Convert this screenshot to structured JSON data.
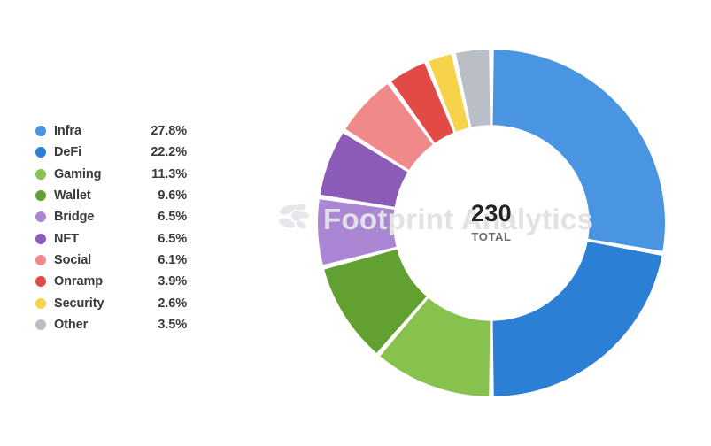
{
  "center": {
    "value": "230",
    "label": "TOTAL"
  },
  "watermark": {
    "text": "Footprint Analytics",
    "icon": "footprint-pinwheel-logo",
    "color": "#e2e2e6"
  },
  "legend": {
    "items": [
      {
        "label": "Infra",
        "value": "27.8%",
        "color": "#4a95e2"
      },
      {
        "label": "DeFi",
        "value": "22.2%",
        "color": "#2b7fd4"
      },
      {
        "label": "Gaming",
        "value": "11.3%",
        "color": "#86c24d"
      },
      {
        "label": "Wallet",
        "value": "9.6%",
        "color": "#63a032"
      },
      {
        "label": "Bridge",
        "value": "6.5%",
        "color": "#ab86d4"
      },
      {
        "label": "NFT",
        "value": "6.5%",
        "color": "#8b5bb8"
      },
      {
        "label": "Social",
        "value": "6.1%",
        "color": "#f08a8a"
      },
      {
        "label": "Onramp",
        "value": "3.9%",
        "color": "#e24b45"
      },
      {
        "label": "Security",
        "value": "2.6%",
        "color": "#f6d349"
      },
      {
        "label": "Other",
        "value": "3.5%",
        "color": "#b9bec7"
      }
    ]
  },
  "chart_data": {
    "type": "pie",
    "variant": "donut",
    "title": "",
    "total": 230,
    "total_label": "TOTAL",
    "unit": "%",
    "start_angle_deg": 0,
    "direction": "clockwise",
    "inner_radius_ratio": 0.565,
    "gap_deg": 1.6,
    "legend_position": "left",
    "categories": [
      "Infra",
      "DeFi",
      "Gaming",
      "Wallet",
      "Bridge",
      "NFT",
      "Social",
      "Onramp",
      "Security",
      "Other"
    ],
    "values": [
      27.8,
      22.2,
      11.3,
      9.6,
      6.5,
      6.5,
      6.1,
      3.9,
      2.6,
      3.5
    ],
    "colors": [
      "#4a95e2",
      "#2b7fd4",
      "#86c24d",
      "#63a032",
      "#ab86d4",
      "#8b5bb8",
      "#f08a8a",
      "#e24b45",
      "#f6d349",
      "#b9bec7"
    ],
    "labels": [
      "27.8%",
      "22.2%",
      "11.3%",
      "9.6%",
      "6.5%",
      "6.5%",
      "6.1%",
      "3.9%",
      "2.6%",
      "3.5%"
    ]
  }
}
